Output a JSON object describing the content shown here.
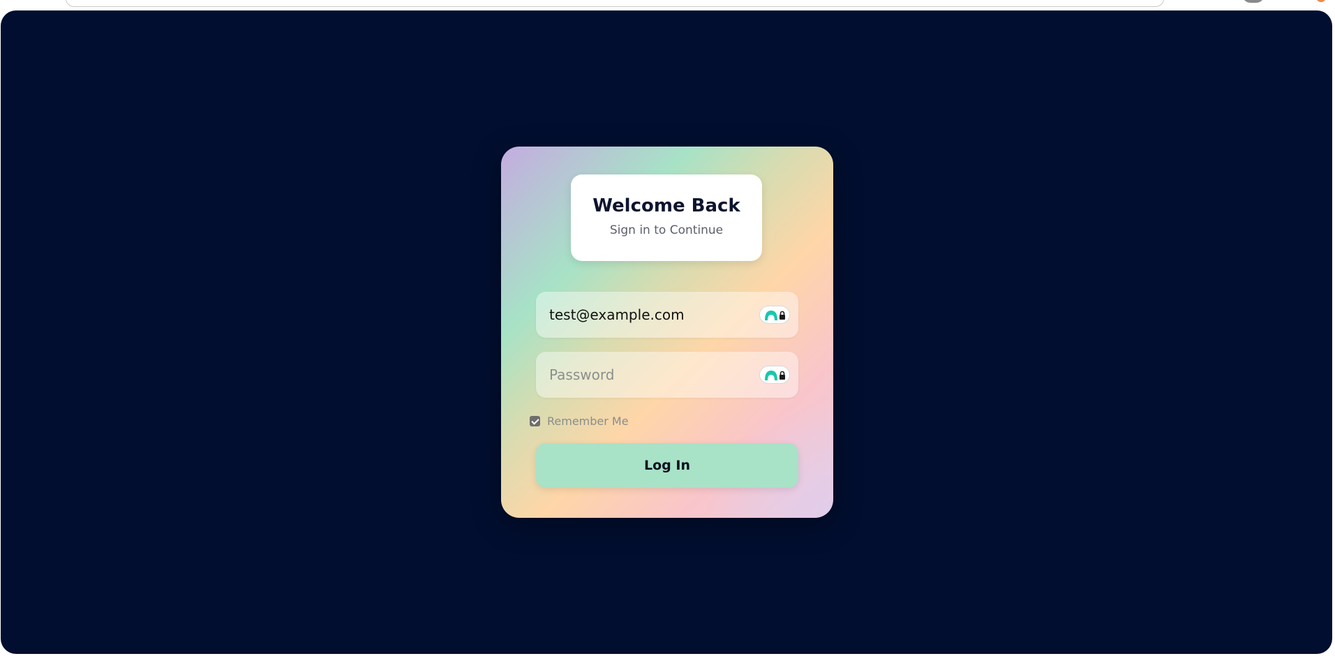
{
  "login": {
    "title": "Welcome Back",
    "subtitle": "Sign in to Continue",
    "email_value": "test@example.com",
    "password_placeholder": "Password",
    "remember_label": "Remember Me",
    "remember_checked": true,
    "login_button": "Log In"
  },
  "icons": {
    "password_manager": "password-manager-lock-icon"
  },
  "colors": {
    "page_background": "#010e2f",
    "card_gradient": [
      "#c4ace0",
      "#a7e2c6",
      "#fed6a8",
      "#f9c5cb",
      "#e8cde2"
    ],
    "button_background": "#a8e2c7",
    "title_color": "#0d1430"
  }
}
